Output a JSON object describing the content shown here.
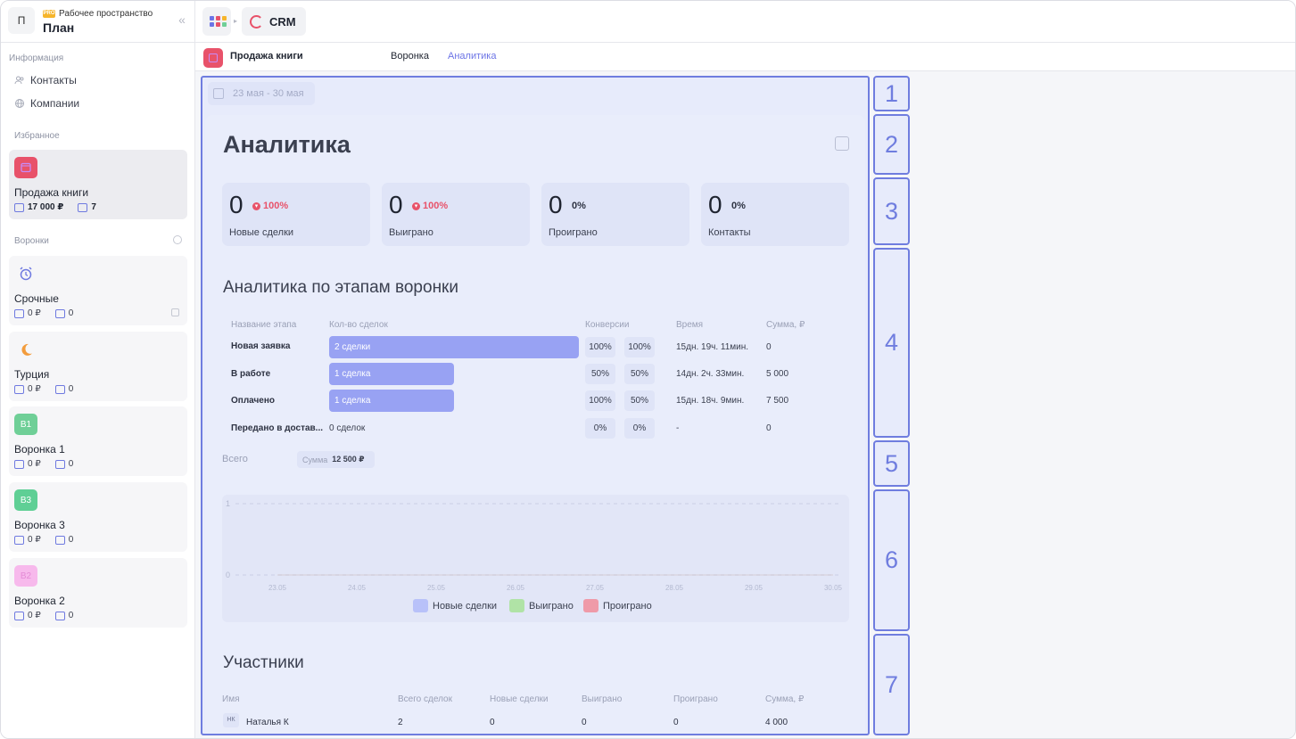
{
  "workspace": {
    "avatar": "П",
    "badge": "PRO",
    "label": "Рабочее пространство",
    "title": "План"
  },
  "sidebar": {
    "info_label": "Информация",
    "info_items": [
      {
        "label": "Контакты"
      },
      {
        "label": "Компании"
      }
    ],
    "fav_label": "Избранное",
    "fav": {
      "name": "Продажа книги",
      "sum": "17 000 ₽",
      "count": "7"
    },
    "funnels_label": "Воронки",
    "funnels": [
      {
        "name": "Срочные",
        "sum": "0 ₽",
        "count": "0",
        "icon": "alarm-clock-icon"
      },
      {
        "name": "Турция",
        "sum": "0 ₽",
        "count": "0",
        "icon": "moon-icon"
      },
      {
        "name": "Воронка 1",
        "sum": "0 ₽",
        "count": "0",
        "code": "В1",
        "color": "#6fcf97"
      },
      {
        "name": "Воронка 3",
        "sum": "0 ₽",
        "count": "0",
        "code": "В3",
        "color": "#5fcf95"
      },
      {
        "name": "Воронка 2",
        "sum": "0 ₽",
        "count": "0",
        "code": "В2",
        "color": "#f7b9ec"
      }
    ]
  },
  "header": {
    "app": "CRM"
  },
  "subbar": {
    "title": "Продажа книги",
    "tabs": [
      {
        "label": "Воронка"
      },
      {
        "label": "Аналитика"
      }
    ]
  },
  "date_range": "23 мая - 30 мая",
  "analytics": {
    "title": "Аналитика",
    "stats": [
      {
        "value": "0",
        "pct": "100%",
        "label": "Новые сделки"
      },
      {
        "value": "0",
        "pct": "100%",
        "label": "Выиграно"
      },
      {
        "value": "0",
        "pct": "0%",
        "label": "Проиграно"
      },
      {
        "value": "0",
        "pct": "0%",
        "label": "Контакты"
      }
    ],
    "stages_title": "Аналитика по этапам воронки",
    "stage_headers": {
      "name": "Название этапа",
      "deals": "Кол-во сделок",
      "conv": "Конверсии",
      "time": "Время",
      "sum": "Сумма, ₽"
    },
    "stages": [
      {
        "name": "Новая заявка",
        "deals": "2 сделки",
        "share": 1.0,
        "conv1": "100%",
        "conv2": "100%",
        "time": "15дн. 19ч. 11мин.",
        "sum": "0"
      },
      {
        "name": "В работе",
        "deals": "1 сделка",
        "share": 0.5,
        "conv1": "50%",
        "conv2": "50%",
        "time": "14дн. 2ч. 33мин.",
        "sum": "5 000"
      },
      {
        "name": "Оплачено",
        "deals": "1 сделка",
        "share": 0.5,
        "conv1": "100%",
        "conv2": "50%",
        "time": "15дн. 18ч. 9мин.",
        "sum": "7 500"
      },
      {
        "name": "Передано в достав...",
        "deals": "0 сделок",
        "share": 0,
        "conv1": "0%",
        "conv2": "0%",
        "time": "-",
        "sum": "0"
      }
    ],
    "total_label": "Всего",
    "total_sum_label": "Сумма",
    "total_sum": "12 500 ₽",
    "participants_title": "Участники",
    "participant_headers": {
      "name": "Имя",
      "total": "Всего сделок",
      "new": "Новые сделки",
      "won": "Выиграно",
      "lost": "Проиграно",
      "sum": "Сумма, ₽"
    },
    "participants": [
      {
        "initials": "НК",
        "name": "Наталья К",
        "total": "2",
        "new": "0",
        "won": "0",
        "lost": "0",
        "sum": "4 000"
      }
    ]
  },
  "chart_data": {
    "type": "line",
    "x": [
      "23.05",
      "24.05",
      "25.05",
      "26.05",
      "27.05",
      "28.05",
      "29.05",
      "30.05"
    ],
    "ylim": [
      0,
      1
    ],
    "yticks": [
      "1",
      "0"
    ],
    "series": [
      {
        "name": "Новые сделки",
        "values": [
          0,
          0,
          0,
          0,
          0,
          0,
          0,
          0
        ],
        "color": "#b8c1f9"
      },
      {
        "name": "Выиграно",
        "values": [
          0,
          0,
          0,
          0,
          0,
          0,
          0,
          0
        ],
        "color": "#b0e3a6"
      },
      {
        "name": "Проиграно",
        "values": [
          0,
          0,
          0,
          0,
          0,
          0,
          0,
          0
        ],
        "color": "#ef9aa8"
      }
    ],
    "grid": true,
    "legend": "bottom"
  },
  "section_markers": [
    "1",
    "2",
    "3",
    "4",
    "5",
    "6",
    "7"
  ],
  "colors": {
    "accent": "#6f7ddf",
    "bar": "#98a2f3",
    "danger": "#e8526a",
    "fav_icon": "#e8526a"
  }
}
